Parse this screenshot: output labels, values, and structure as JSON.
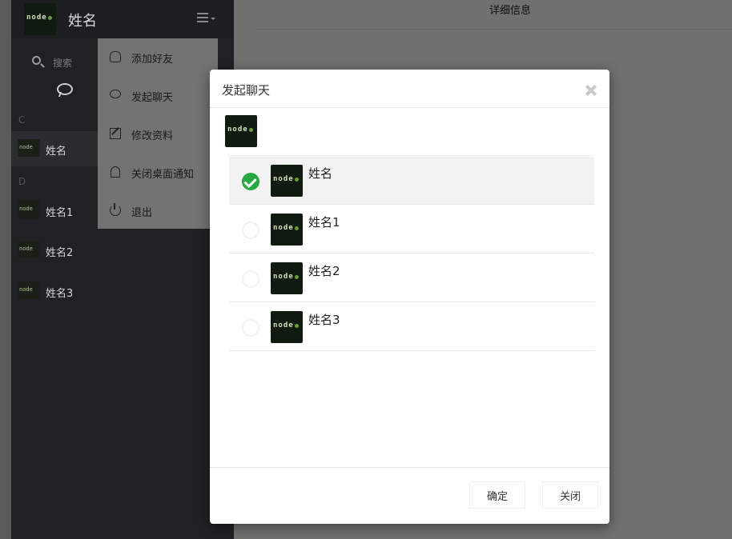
{
  "sidebar": {
    "user_name": "姓名",
    "search_placeholder": "搜索",
    "groups": [
      "C",
      "D"
    ],
    "contacts": [
      {
        "name": "姓名"
      },
      {
        "name": "姓名1"
      },
      {
        "name": "姓名2"
      },
      {
        "name": "姓名3"
      }
    ]
  },
  "menu": {
    "items": [
      {
        "label": "添加好友",
        "icon": "user-icon"
      },
      {
        "label": "发起聊天",
        "icon": "chat-bubble-icon"
      },
      {
        "label": "修改资料",
        "icon": "edit-icon"
      },
      {
        "label": "关闭桌面通知",
        "icon": "bell-icon"
      },
      {
        "label": "退出",
        "icon": "power-icon"
      }
    ]
  },
  "detail": {
    "title": "详细信息"
  },
  "modal": {
    "title": "发起聊天",
    "friends": [
      {
        "name": "姓名",
        "selected": true
      },
      {
        "name": "姓名1",
        "selected": false
      },
      {
        "name": "姓名2",
        "selected": false
      },
      {
        "name": "姓名3",
        "selected": false
      }
    ],
    "ok_label": "确定",
    "close_label": "关闭"
  },
  "colors": {
    "check_green": "#27a844",
    "sidebar_bg": "#1f2124",
    "overlay_gray": "#707070"
  }
}
